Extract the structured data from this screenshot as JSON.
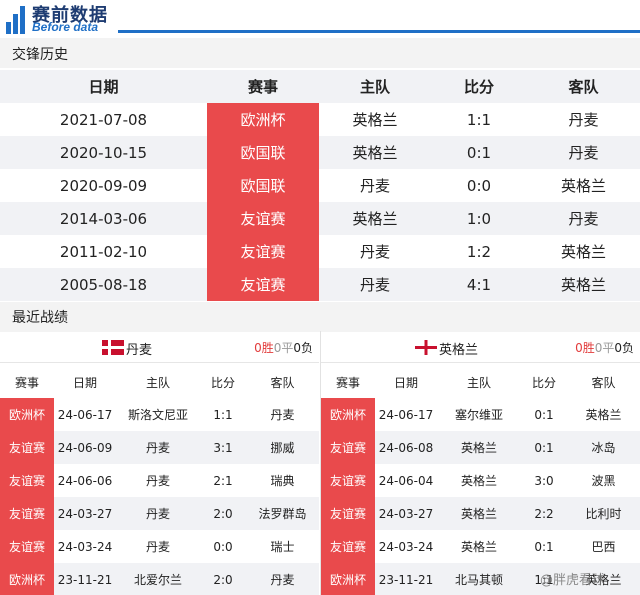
{
  "brand": {
    "name_cn": "赛前数据",
    "name_en": "Before data",
    "color": "#1f6fc6"
  },
  "history": {
    "title": "交锋历史",
    "columns": [
      "日期",
      "赛事",
      "主队",
      "比分",
      "客队"
    ],
    "rows": [
      [
        "2021-07-08",
        "欧洲杯",
        "英格兰",
        "1:1",
        "丹麦"
      ],
      [
        "2020-10-15",
        "欧国联",
        "英格兰",
        "0:1",
        "丹麦"
      ],
      [
        "2020-09-09",
        "欧国联",
        "丹麦",
        "0:0",
        "英格兰"
      ],
      [
        "2014-03-06",
        "友谊赛",
        "英格兰",
        "1:0",
        "丹麦"
      ],
      [
        "2011-02-10",
        "友谊赛",
        "丹麦",
        "1:2",
        "英格兰"
      ],
      [
        "2005-08-18",
        "友谊赛",
        "丹麦",
        "4:1",
        "英格兰"
      ]
    ]
  },
  "recent": {
    "title": "最近战绩",
    "columns": [
      "赛事",
      "日期",
      "主队",
      "比分",
      "客队"
    ],
    "left": {
      "team": "丹麦",
      "wins": "0胜",
      "draws": "0平",
      "losses": "0负",
      "rows": [
        [
          "欧洲杯",
          "24-06-17",
          "斯洛文尼亚",
          "1:1",
          "丹麦"
        ],
        [
          "友谊赛",
          "24-06-09",
          "丹麦",
          "3:1",
          "挪威"
        ],
        [
          "友谊赛",
          "24-06-06",
          "丹麦",
          "2:1",
          "瑞典"
        ],
        [
          "友谊赛",
          "24-03-27",
          "丹麦",
          "2:0",
          "法罗群岛"
        ],
        [
          "友谊赛",
          "24-03-24",
          "丹麦",
          "0:0",
          "瑞士"
        ],
        [
          "欧洲杯",
          "23-11-21",
          "北爱尔兰",
          "2:0",
          "丹麦"
        ]
      ]
    },
    "right": {
      "team": "英格兰",
      "wins": "0胜",
      "draws": "0平",
      "losses": "0负",
      "rows": [
        [
          "欧洲杯",
          "24-06-17",
          "塞尔维亚",
          "0:1",
          "英格兰"
        ],
        [
          "友谊赛",
          "24-06-08",
          "英格兰",
          "0:1",
          "冰岛"
        ],
        [
          "友谊赛",
          "24-06-04",
          "英格兰",
          "3:0",
          "波黑"
        ],
        [
          "友谊赛",
          "24-03-27",
          "英格兰",
          "2:2",
          "比利时"
        ],
        [
          "友谊赛",
          "24-03-24",
          "英格兰",
          "0:1",
          "巴西"
        ],
        [
          "欧洲杯",
          "23-11-21",
          "北马其顿",
          "1:1",
          "英格兰"
        ]
      ]
    }
  },
  "watermark": "@胖虎看球",
  "colors": {
    "competition_bg": "#e94a4c",
    "win": "#e23b3b",
    "row_alt": "#f1f2f5"
  }
}
